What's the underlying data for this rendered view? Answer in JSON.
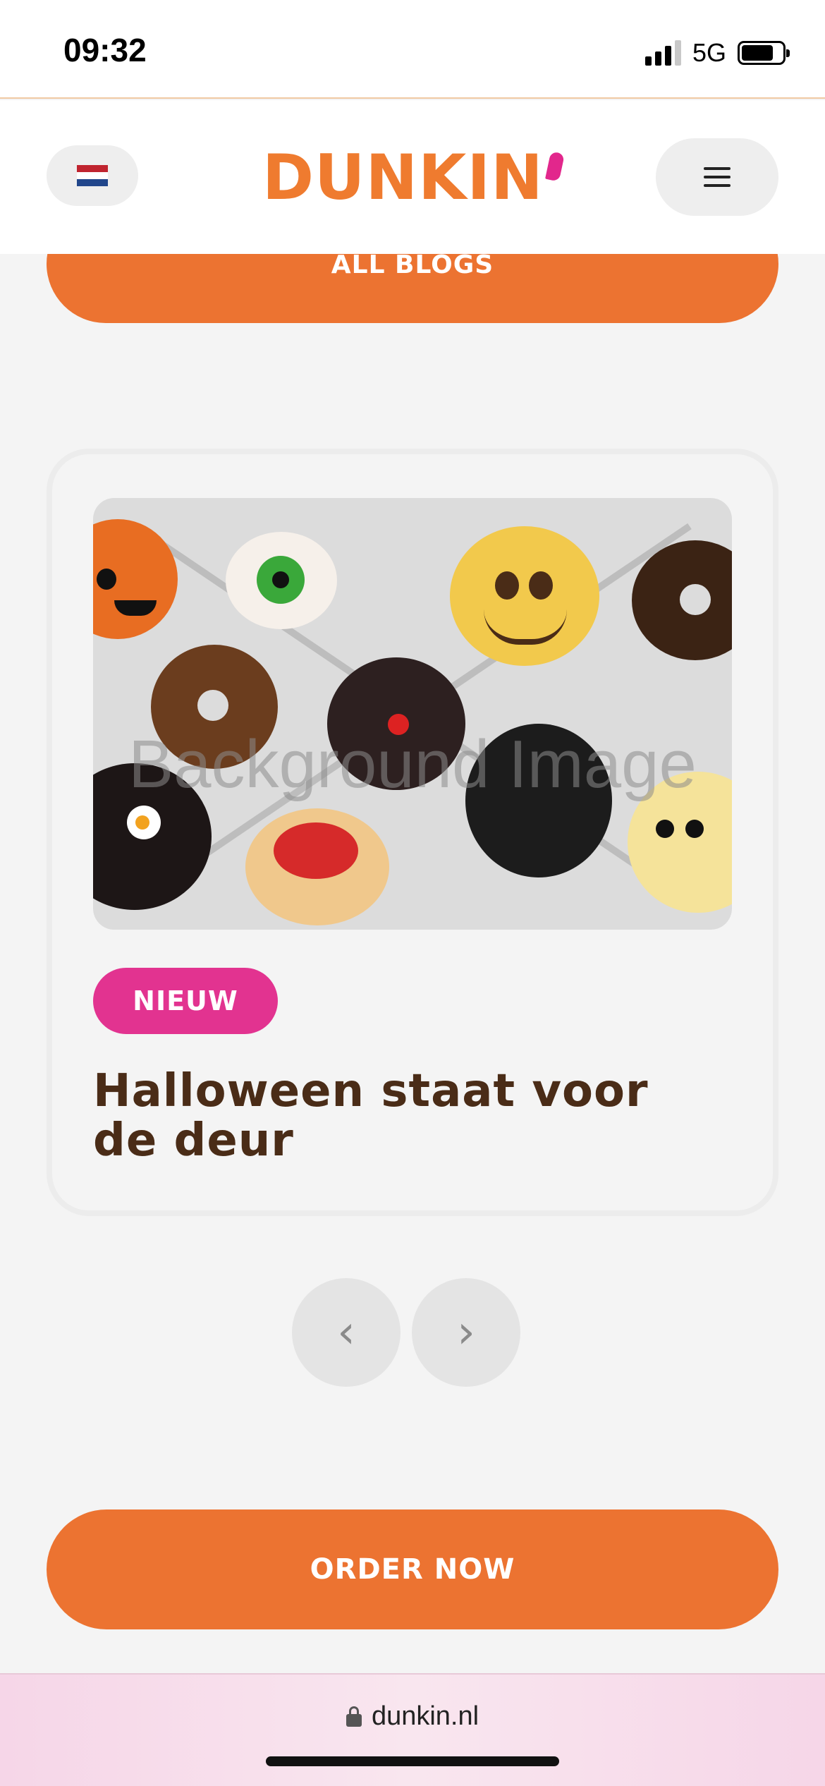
{
  "status_bar": {
    "time": "09:32",
    "network": "5G",
    "icons": [
      "signal-icon",
      "battery-icon"
    ]
  },
  "header": {
    "language_flag": "netherlands-flag-icon",
    "brand": "DUNKIN",
    "menu_icon": "hamburger-menu-icon",
    "colors": {
      "brand_orange": "#ef7b2f",
      "brand_pink": "#e2278c"
    }
  },
  "all_blogs_button": {
    "label": "ALL BLOGS"
  },
  "blog_card": {
    "image_placeholder": "Background Image",
    "badge": "NIEUW",
    "title": "Halloween staat voor de deur",
    "colors": {
      "badge": "#e23390",
      "title": "#4a2c17"
    }
  },
  "carousel": {
    "prev_icon": "chevron-left-icon",
    "next_icon": "chevron-right-icon",
    "prev_glyph": "‹",
    "next_glyph": "›"
  },
  "order_now_button": {
    "label": "ORDER NOW",
    "color": "#ec7331"
  },
  "browser": {
    "url": "dunkin.nl",
    "icon": "lock-icon"
  }
}
